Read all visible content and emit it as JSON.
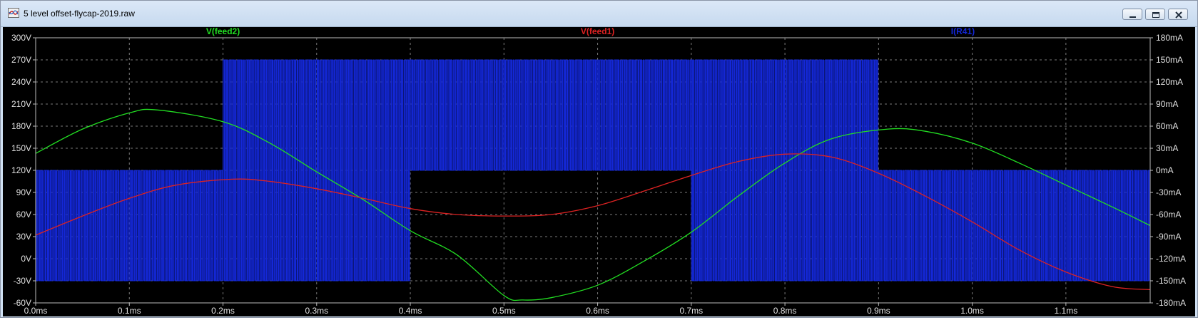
{
  "window": {
    "title": "5 level offset-flycap-2019.raw",
    "icon": "waveform-viewer-icon",
    "buttons": [
      "minimize-icon",
      "restore-icon",
      "close-icon"
    ]
  },
  "chart_data": {
    "type": "line",
    "background": "#000000",
    "grid": true,
    "x": {
      "unit": "ms",
      "range": [
        0,
        1.19
      ],
      "ticks": [
        "0.0ms",
        "0.1ms",
        "0.2ms",
        "0.3ms",
        "0.4ms",
        "0.5ms",
        "0.6ms",
        "0.7ms",
        "0.8ms",
        "0.9ms",
        "1.0ms",
        "1.1ms"
      ]
    },
    "y_left": {
      "unit": "V",
      "range": [
        -60,
        300
      ],
      "ticks": [
        "300V",
        "270V",
        "240V",
        "210V",
        "180V",
        "150V",
        "120V",
        "90V",
        "60V",
        "30V",
        "0V",
        "-30V",
        "-60V"
      ]
    },
    "y_right": {
      "unit": "mA",
      "range": [
        -180,
        180
      ],
      "ticks": [
        "180mA",
        "150mA",
        "120mA",
        "90mA",
        "60mA",
        "30mA",
        "0mA",
        "-30mA",
        "-60mA",
        "-90mA",
        "-120mA",
        "-150mA",
        "-180mA"
      ]
    },
    "series": [
      {
        "name": "V(feed2)",
        "axis": "left",
        "color": "#22dd22",
        "x": [
          0,
          0.05,
          0.1,
          0.13,
          0.2,
          0.25,
          0.3,
          0.35,
          0.4,
          0.45,
          0.5,
          0.52,
          0.55,
          0.6,
          0.65,
          0.7,
          0.75,
          0.8,
          0.85,
          0.91,
          0.95,
          1.0,
          1.05,
          1.1,
          1.15,
          1.19
        ],
        "values": [
          143,
          176,
          198,
          202,
          186,
          157,
          118,
          80,
          38,
          5,
          -50,
          -56,
          -53,
          -36,
          -3,
          36,
          85,
          130,
          163,
          176,
          173,
          157,
          130,
          100,
          70,
          45
        ]
      },
      {
        "name": "V(feed1)",
        "axis": "left",
        "color": "#dd2222",
        "x": [
          0,
          0.05,
          0.1,
          0.15,
          0.21,
          0.25,
          0.3,
          0.35,
          0.4,
          0.45,
          0.5,
          0.55,
          0.6,
          0.65,
          0.7,
          0.75,
          0.8,
          0.85,
          0.9,
          0.95,
          1.0,
          1.05,
          1.1,
          1.15,
          1.19
        ],
        "values": [
          32,
          58,
          82,
          100,
          108,
          105,
          95,
          82,
          68,
          60,
          58,
          60,
          72,
          92,
          113,
          132,
          142,
          138,
          116,
          85,
          50,
          12,
          -18,
          -38,
          -42
        ]
      },
      {
        "name": "I(R41)",
        "axis": "right",
        "color": "#1428d8",
        "style": "switching",
        "segments": [
          {
            "from": 0.0,
            "to": 0.2,
            "levels": [
              0,
              -150
            ]
          },
          {
            "from": 0.2,
            "to": 0.4,
            "levels": [
              150,
              -150
            ]
          },
          {
            "from": 0.4,
            "to": 0.7,
            "levels": [
              150,
              0
            ]
          },
          {
            "from": 0.7,
            "to": 0.9,
            "levels": [
              150,
              -150
            ]
          },
          {
            "from": 0.9,
            "to": 1.19,
            "levels": [
              0,
              -150
            ]
          }
        ]
      }
    ]
  }
}
